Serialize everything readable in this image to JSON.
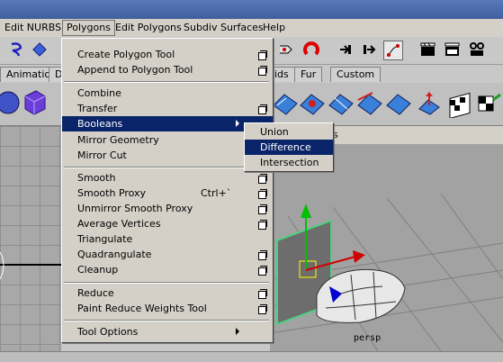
{
  "menubar": {
    "items": [
      "Edit NURBS",
      "Polygons",
      "Edit Polygons",
      "Subdiv Surfaces",
      "Help"
    ],
    "active": "Polygons"
  },
  "shelf_tabs": [
    "Animation",
    "D",
    "ids",
    "Fur",
    "Custom"
  ],
  "polygons_menu": {
    "items": [
      {
        "label": "Create Polygon Tool",
        "option_box": true
      },
      {
        "label": "Append to Polygon Tool",
        "option_box": true
      },
      {
        "label": "Combine"
      },
      {
        "label": "Transfer",
        "option_box": true
      },
      {
        "label": "Booleans",
        "submenu": true,
        "highlighted": true
      },
      {
        "label": "Mirror Geometry",
        "option_box": true
      },
      {
        "label": "Mirror Cut",
        "option_box": true
      },
      {
        "label": "Smooth",
        "option_box": true
      },
      {
        "label": "Smooth Proxy",
        "shortcut": "Ctrl+`",
        "option_box": true
      },
      {
        "label": "Unmirror Smooth Proxy",
        "option_box": true
      },
      {
        "label": "Average Vertices",
        "option_box": true
      },
      {
        "label": "Triangulate"
      },
      {
        "label": "Quadrangulate",
        "option_box": true
      },
      {
        "label": "Cleanup",
        "option_box": true
      },
      {
        "label": "Reduce",
        "option_box": true
      },
      {
        "label": "Paint Reduce Weights Tool",
        "option_box": true
      },
      {
        "label": "Tool Options",
        "submenu": true
      }
    ]
  },
  "booleans_submenu": {
    "items": [
      "Union",
      "Difference",
      "Intersection"
    ],
    "highlighted": "Difference"
  },
  "panel_bar_fragment": "s",
  "viewport": {
    "camera_label": "persp"
  },
  "colors": {
    "highlight": "#0a246a",
    "menu_bg": "#d4d0c8"
  },
  "icons": [
    "lasso-select-icon",
    "move-icon",
    "magnet-snap-icon",
    "render-icon",
    "ipr-render-icon",
    "render-globals-icon"
  ]
}
